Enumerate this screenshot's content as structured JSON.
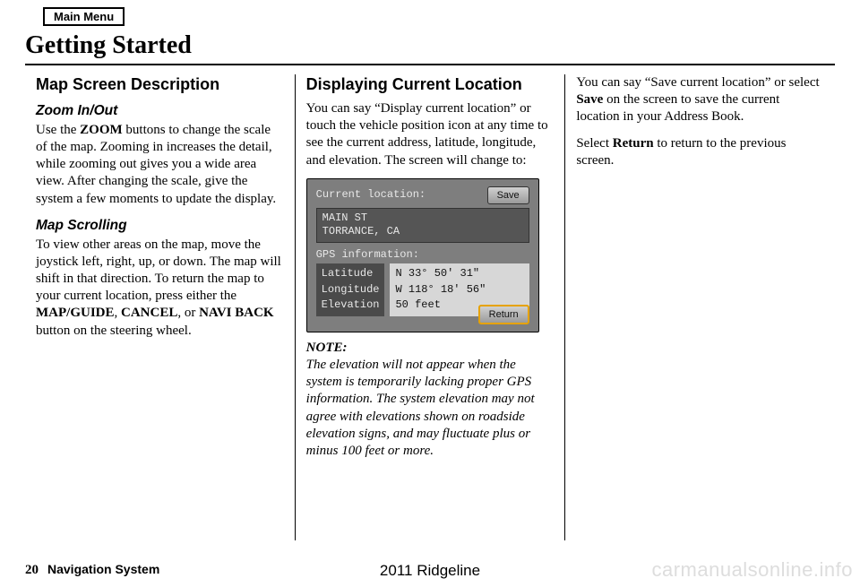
{
  "menu_button": "Main Menu",
  "title": "Getting Started",
  "col1": {
    "h2": "Map Screen Description",
    "zoom_h": "Zoom In/Out",
    "zoom_p_pre": "Use the ",
    "zoom_bold": "ZOOM",
    "zoom_p_post": " buttons to change the scale of the map. Zooming in increases the detail, while zooming out gives you a wide area view. After changing the scale, give the system a few moments to update the display.",
    "scroll_h": "Map Scrolling",
    "scroll_p_pre": "To view other areas on the map, move the joystick left, right, up, or down. The map will shift in that direction. To return the map to your current location, press either the ",
    "scroll_b1": "MAP/GUIDE",
    "scroll_mid1": ", ",
    "scroll_b2": "CANCEL",
    "scroll_mid2": ", or ",
    "scroll_b3": "NAVI BACK",
    "scroll_post": " button on the steering wheel."
  },
  "col2": {
    "h2": "Displaying Current Location",
    "p": "You can say “Display current location” or touch the vehicle position icon at any time to see the current address, latitude, longitude, and elevation. The screen will change to:",
    "screen": {
      "cur_loc_label": "Current location:",
      "save_btn": "Save",
      "addr1": "MAIN ST",
      "addr2": "TORRANCE, CA",
      "gps_label": "GPS information:",
      "lat_l": "Latitude",
      "lon_l": "Longitude",
      "ele_l": "Elevation",
      "lat_v": "N 33° 50' 31\"",
      "lon_v": "W 118° 18' 56\"",
      "ele_v": "50 feet",
      "return_btn": "Return"
    },
    "note_label": "NOTE:",
    "note_body": "The elevation will not appear when the system is temporarily lacking proper GPS information. The system elevation may not agree with elevations shown on roadside elevation signs, and may fluctuate plus or minus 100 feet or more."
  },
  "col3": {
    "p1_pre": "You can say “Save current location” or select ",
    "p1_b": "Save",
    "p1_post": " on the screen to save the current location in your Address Book.",
    "p2_pre": "Select ",
    "p2_b": "Return",
    "p2_post": " to return to the previous screen."
  },
  "footer": {
    "page": "20",
    "system": "Navigation System",
    "model": "2011 Ridgeline"
  },
  "watermark": "carmanualsonline.info"
}
